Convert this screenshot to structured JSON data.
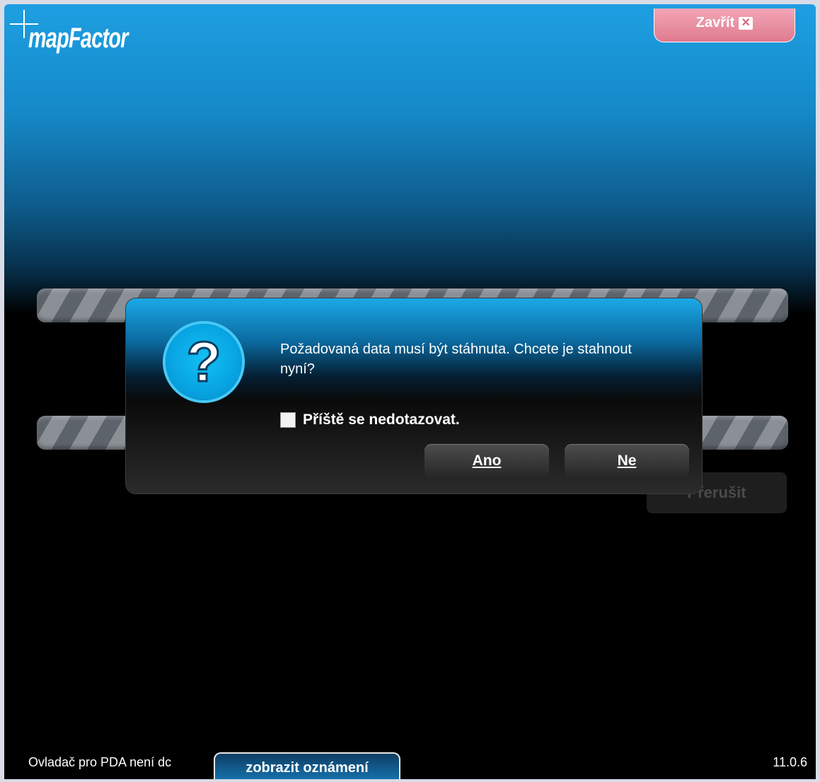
{
  "app": {
    "logo_text": "mapFactor",
    "close_label": "Zavřít",
    "close_icon": "close-x-icon"
  },
  "main": {
    "abort_label": "Přerušit"
  },
  "dialog": {
    "icon": "question-icon",
    "icon_glyph": "?",
    "message": "Požadovaná data musí být stáhnuta. Chcete je stahnout nyní?",
    "checkbox_label": "Příště se nedotazovat.",
    "checkbox_checked": false,
    "yes_label": "Ano",
    "no_label": "Ne"
  },
  "footer": {
    "status_text": "Ovladač pro PDA není dc",
    "notifications_label": "zobrazit oznámení",
    "version": "11.0.6"
  },
  "colors": {
    "accent_blue": "#1aa9e6",
    "close_pink": "#e07a90"
  }
}
